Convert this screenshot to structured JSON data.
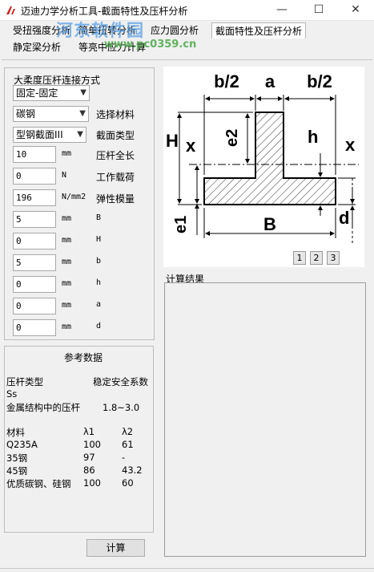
{
  "window": {
    "title": "迈迪力学分析工具-截面特性及压杆分析",
    "minimize": "—",
    "maximize": "☐",
    "close": "✕"
  },
  "watermark": {
    "text": "河东软件园",
    "url": "www.pc0359.cn"
  },
  "tabs": [
    {
      "label": "受扭强度分析"
    },
    {
      "label": "简单扭转分析"
    },
    {
      "label": "应力圆分析"
    },
    {
      "label": "截面特性及压杆分析"
    },
    {
      "label": "静定梁分析"
    },
    {
      "label": "等亮中应力计算"
    }
  ],
  "form": {
    "connection_label": "大柔度压杆连接方式",
    "connection_value": "固定-固定",
    "material_value": "碳钢",
    "material_label": "选择材料",
    "section_value": "型钢截面III",
    "section_label": "截面类型",
    "fields": [
      {
        "value": "10",
        "unit": "mm",
        "label": "压杆全长"
      },
      {
        "value": "0",
        "unit": "N",
        "label": "工作载荷"
      },
      {
        "value": "196",
        "unit": "N/mm2",
        "label": "弹性模量"
      },
      {
        "value": "5",
        "unit": "mm",
        "label": "B"
      },
      {
        "value": "0",
        "unit": "mm",
        "label": "H"
      },
      {
        "value": "5",
        "unit": "mm",
        "label": "b"
      },
      {
        "value": "0",
        "unit": "mm",
        "label": "h"
      },
      {
        "value": "0",
        "unit": "mm",
        "label": "a"
      },
      {
        "value": "0",
        "unit": "mm",
        "label": "d"
      }
    ]
  },
  "reference": {
    "title": "参考数据",
    "type_header": "压杆类型",
    "safety_header": "稳定安全系数",
    "ss": "Ss",
    "metal_row": "金属结构中的压杆",
    "metal_value": "1.8~3.0",
    "material_col": "材料",
    "lambda1_col": "λ1",
    "lambda2_col": "λ2",
    "rows": [
      {
        "material": "Q235A",
        "l1": "100",
        "l2": "61"
      },
      {
        "material": "35钢",
        "l1": "97",
        "l2": "-"
      },
      {
        "material": "45钢",
        "l1": "86",
        "l2": "43.2"
      },
      {
        "material": "优质碳钢、硅钢",
        "l1": "100",
        "l2": "60"
      }
    ]
  },
  "calculate_button": "计算",
  "diagram": {
    "top_labels": [
      "b/2",
      "a",
      "b/2"
    ],
    "H": "H",
    "x_left": "x",
    "e2": "e2",
    "h": "h",
    "x_right": "x",
    "e1": "e1",
    "B": "B",
    "d": "d"
  },
  "pages": [
    "1",
    "2",
    "3"
  ],
  "result_label": "计算结果"
}
